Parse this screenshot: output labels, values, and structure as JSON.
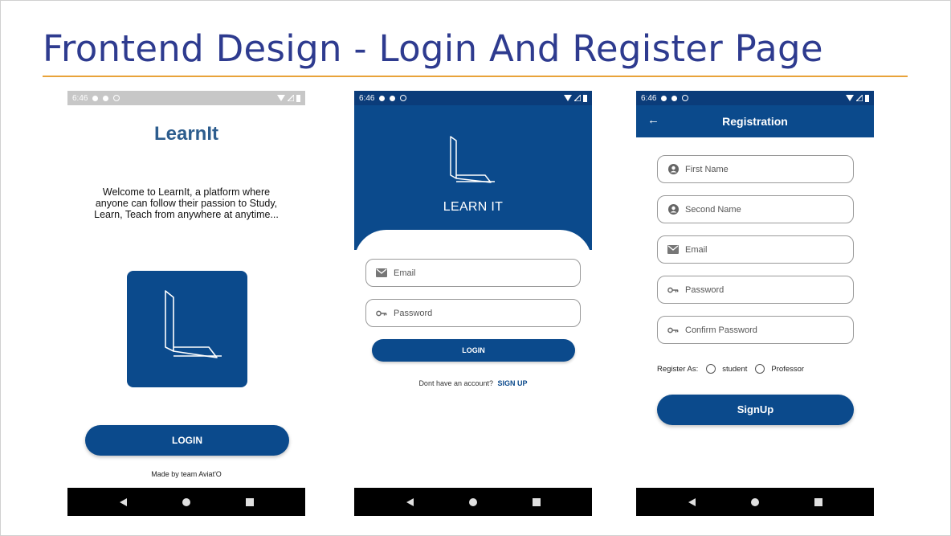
{
  "slide": {
    "title": "Frontend Design - Login And Register Page",
    "accent_color": "#e8a33a",
    "title_color": "#2e3b8f"
  },
  "status_bar": {
    "time": "6:46",
    "icons": [
      "gear-icon",
      "shield-icon",
      "at-icon",
      "wifi-icon",
      "signal-icon",
      "battery-icon"
    ]
  },
  "nav_bar": {
    "icons": [
      "back-triangle-icon",
      "home-circle-icon",
      "recents-square-icon"
    ]
  },
  "brand_color": "#0b4a8c",
  "splash": {
    "app_name": "LearnIt",
    "welcome": "Welcome to LearnIt, a platform where anyone can follow their passion to Study, Learn, Teach from anywhere at anytime...",
    "login_button": "LOGIN",
    "footer": "Made by team Aviat'O"
  },
  "login": {
    "hero_text": "LEARN IT",
    "email_placeholder": "Email",
    "password_placeholder": "Password",
    "login_button": "LOGIN",
    "no_account": "Dont have an account?",
    "signup_link": "SIGN UP"
  },
  "registration": {
    "title": "Registration",
    "back_icon": "arrow-left-icon",
    "fields": [
      {
        "placeholder": "First Name",
        "icon": "person-icon"
      },
      {
        "placeholder": "Second Name",
        "icon": "person-icon"
      },
      {
        "placeholder": "Email",
        "icon": "mail-icon"
      },
      {
        "placeholder": "Password",
        "icon": "key-icon"
      },
      {
        "placeholder": "Confirm Password",
        "icon": "key-icon"
      }
    ],
    "register_as_label": "Register As:",
    "options": [
      "student",
      "Professor"
    ],
    "signup_button": "SignUp"
  }
}
